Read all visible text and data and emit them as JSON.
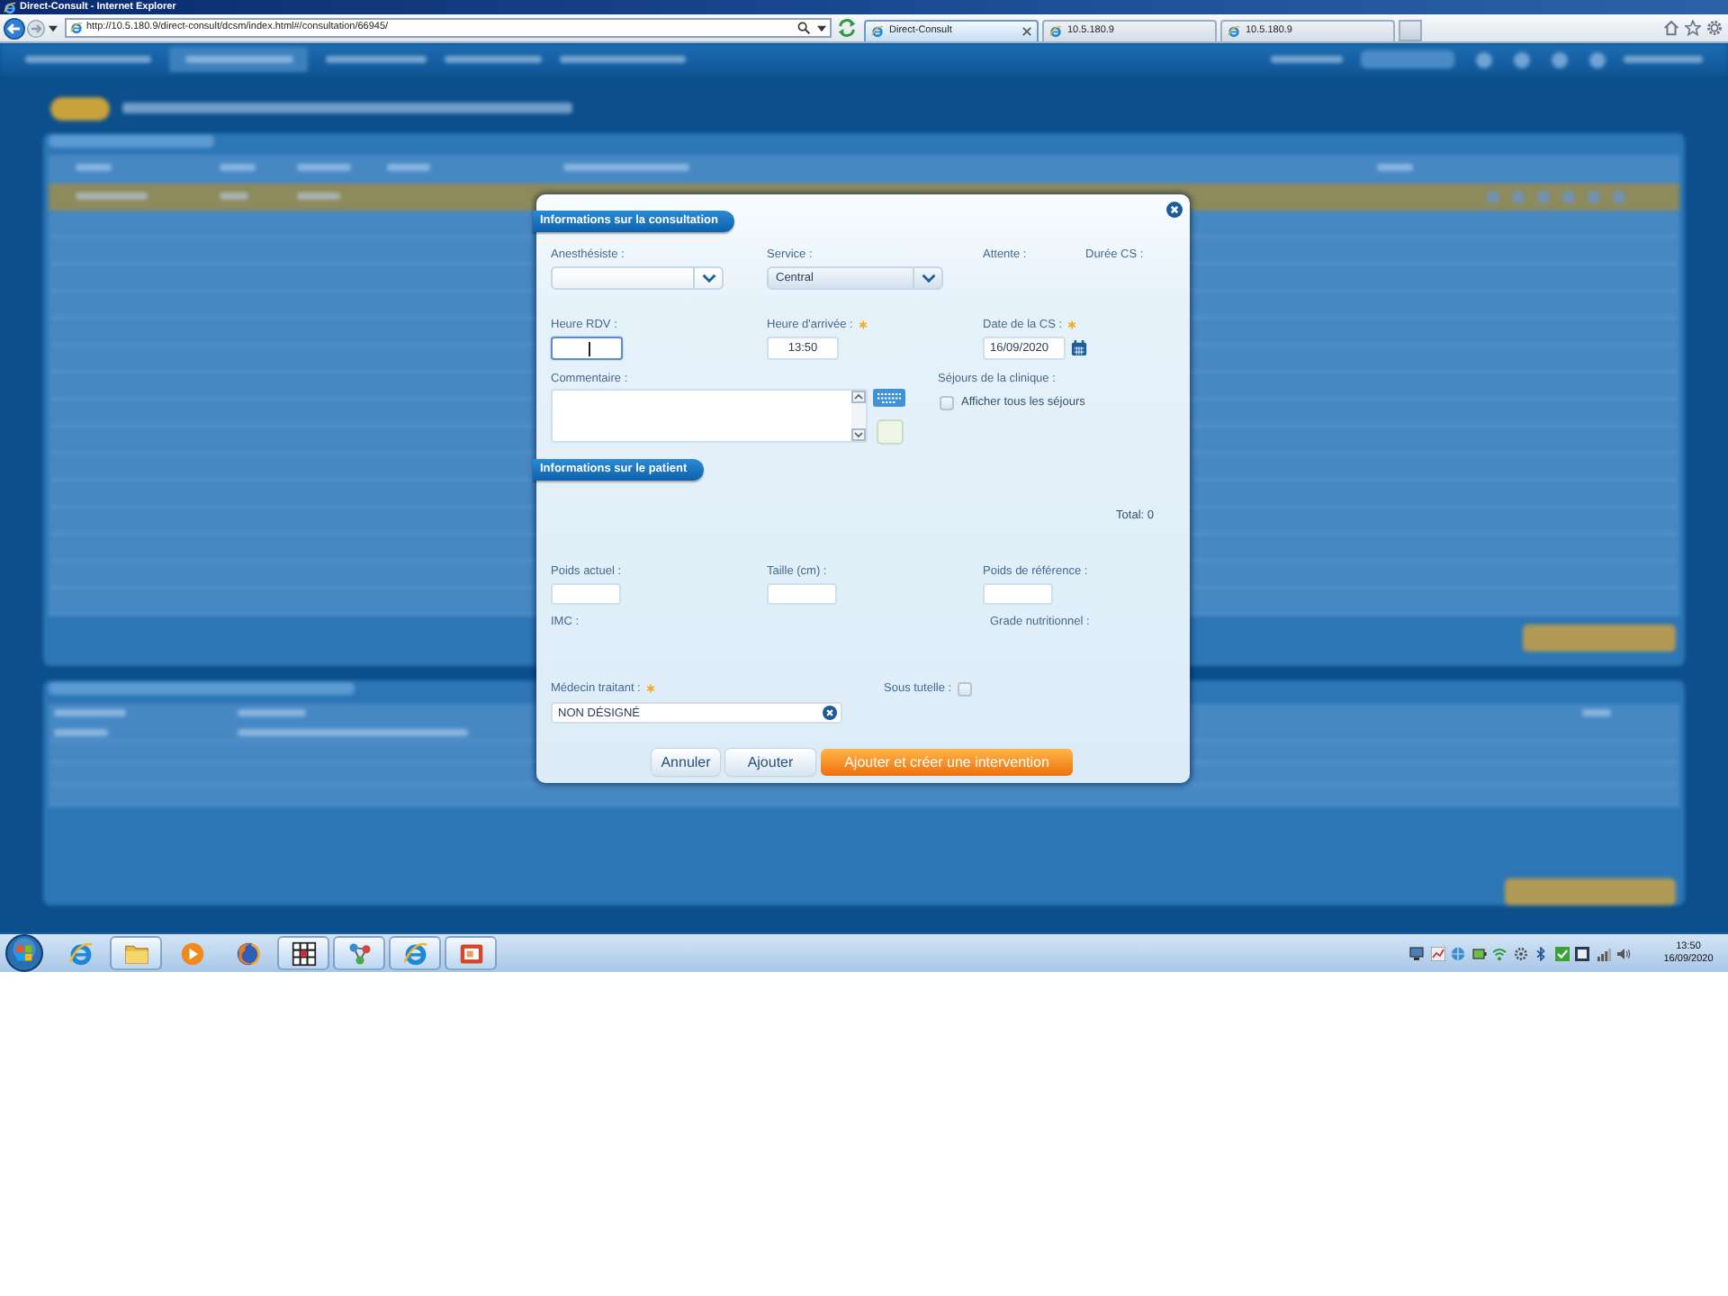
{
  "browser": {
    "title": "Direct-Consult - Internet Explorer",
    "address": "http://10.5.180.9/direct-consult/dcsm/index.html#/consultation/66945/",
    "tabs": [
      {
        "label": "Direct-Consult",
        "selected": true
      },
      {
        "label": "10.5.180.9",
        "selected": false
      },
      {
        "label": "10.5.180.9",
        "selected": false
      }
    ]
  },
  "dialog": {
    "consultation_title": "Informations sur la consultation",
    "anesthesiste": {
      "label": "Anesthésiste :"
    },
    "service": {
      "label": "Service :",
      "value": "Central"
    },
    "attente": {
      "label": "Attente :"
    },
    "duree_cs": {
      "label": "Durée CS :"
    },
    "heure_rdv": {
      "label": "Heure RDV :",
      "focused": true
    },
    "heure_arrivee": {
      "label": "Heure d'arrivée :",
      "required": true,
      "value": "13:50"
    },
    "date_cs": {
      "label": "Date de la CS :",
      "required": true,
      "value": "16/09/2020"
    },
    "commentaire": {
      "label": "Commentaire :"
    },
    "sejours": {
      "label": "Séjours de la clinique :",
      "option": "Afficher tous les séjours",
      "checked": false
    },
    "patient_title": "Informations sur le patient",
    "total": "Total: 0",
    "poids_actuel": {
      "label": "Poids actuel :"
    },
    "taille": {
      "label": "Taille (cm) :"
    },
    "poids_reference": {
      "label": "Poids de référence :"
    },
    "imc": {
      "label": "IMC :"
    },
    "grade_nutritionnel": {
      "label": "Grade nutritionnel :"
    },
    "medecin_traitant": {
      "label": "Médecin traitant :",
      "required": true,
      "value": "NON DÉSIGNÉ"
    },
    "sous_tutelle": {
      "label": "Sous tutelle :",
      "checked": false
    },
    "buttons": [
      {
        "label": "Annuler",
        "kind": "secondary"
      },
      {
        "label": "Ajouter",
        "kind": "secondary"
      },
      {
        "label": "Ajouter et créer une intervention",
        "kind": "primary"
      }
    ]
  },
  "taskbar": {
    "apps": [
      {
        "running": false
      },
      {
        "running": true
      },
      {
        "running": false
      },
      {
        "running": false
      },
      {
        "running": true
      },
      {
        "running": true
      },
      {
        "running": true
      },
      {
        "running": true
      }
    ],
    "time": "13:50",
    "date": "16/09/2020"
  }
}
